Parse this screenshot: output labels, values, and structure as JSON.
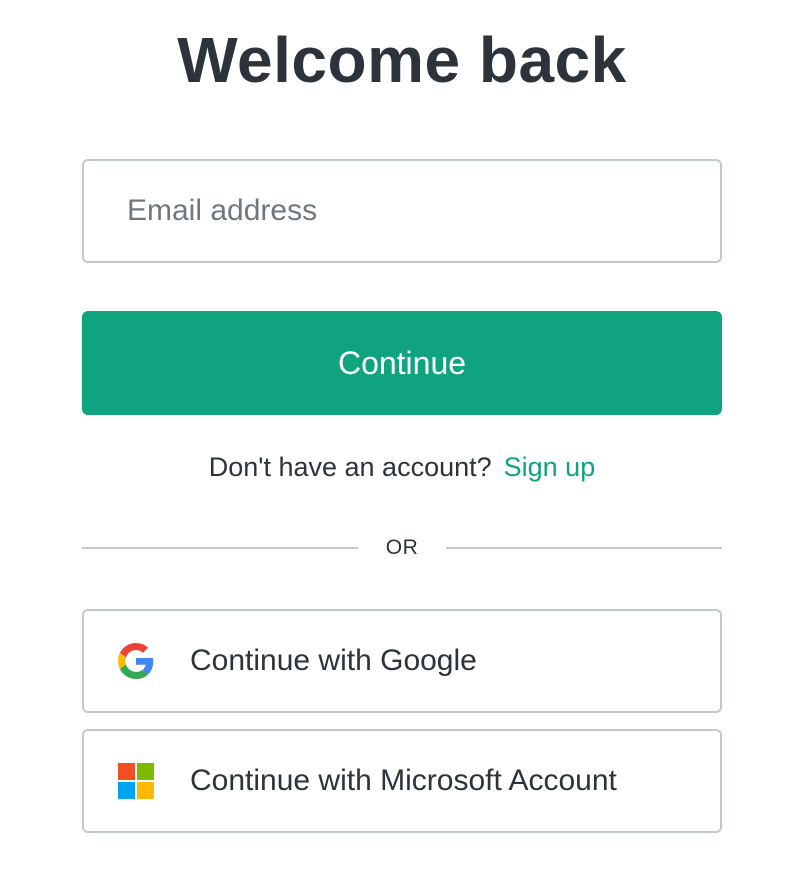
{
  "page": {
    "title": "Welcome back"
  },
  "form": {
    "email_placeholder": "Email address",
    "email_value": "",
    "continue_label": "Continue"
  },
  "signup": {
    "prompt": "Don't have an account?",
    "link_label": "Sign up"
  },
  "divider": {
    "label": "OR"
  },
  "social": {
    "google_label": "Continue with Google",
    "google_icon": "google-logo-icon",
    "microsoft_label": "Continue with Microsoft Account",
    "microsoft_icon": "microsoft-logo-icon"
  },
  "colors": {
    "accent": "#10a37f",
    "text": "#2d333a",
    "border": "#c2c8d0",
    "placeholder": "#6f7780",
    "google_blue": "#4285f4",
    "google_red": "#ea4335",
    "google_yellow": "#fbbc05",
    "google_green": "#34a853",
    "ms_red": "#f25022",
    "ms_green": "#7fba00",
    "ms_blue": "#00a4ef",
    "ms_yellow": "#ffb900"
  }
}
